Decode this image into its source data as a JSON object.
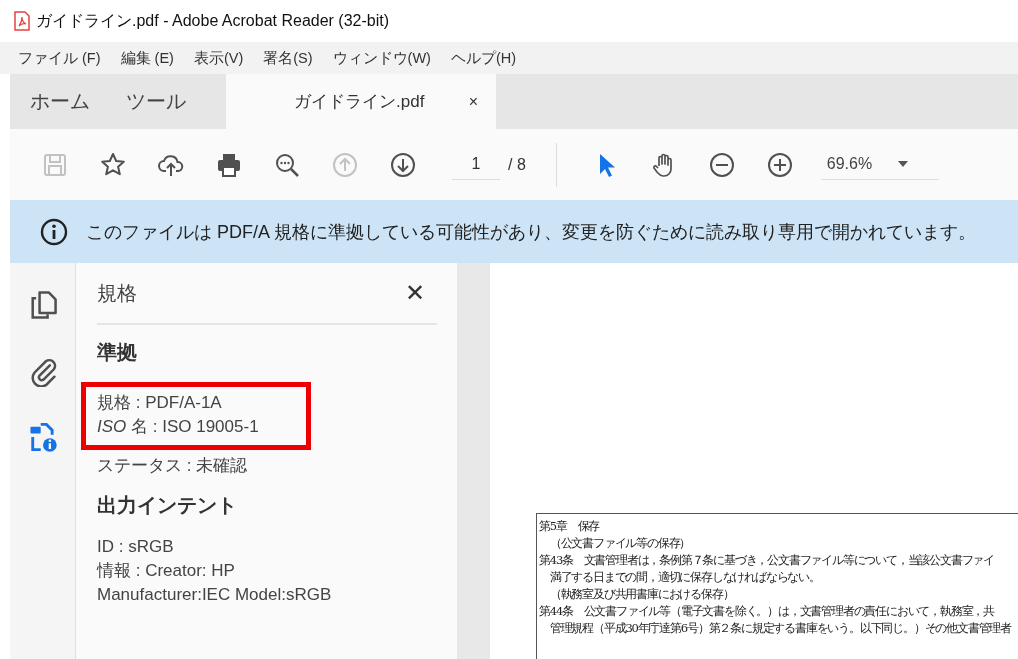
{
  "window": {
    "title": "ガイドライン.pdf - Adobe Acrobat Reader (32-bit)"
  },
  "menu": [
    "ファイル (F)",
    "編集 (E)",
    "表示(V)",
    "署名(S)",
    "ウィンドウ(W)",
    "ヘルプ(H)"
  ],
  "tabs": [
    {
      "label": "ホーム",
      "selected": false
    },
    {
      "label": "ツール",
      "selected": false
    },
    {
      "label": "ガイドライン.pdf",
      "selected": true,
      "close": "×"
    }
  ],
  "toolbar": {
    "buttons": [
      {
        "kind": "save",
        "disabled": true
      },
      {
        "kind": "star",
        "disabled": false
      },
      {
        "kind": "upload",
        "disabled": false
      },
      {
        "kind": "print",
        "disabled": false
      },
      {
        "kind": "find",
        "disabled": false
      },
      {
        "kind": "prev",
        "disabled": true
      },
      {
        "kind": "next",
        "disabled": false
      }
    ],
    "page": "1",
    "page_total": "/ 8",
    "tools": [
      {
        "kind": "pointer",
        "selected": true
      },
      {
        "kind": "hand",
        "selected": false
      },
      {
        "kind": "zoom-out",
        "selected": false
      },
      {
        "kind": "zoom-in",
        "selected": false
      }
    ],
    "zoom": "69.6%"
  },
  "banner": {
    "text": "このファイルは PDF/A 規格に準拠している可能性があり、変更を防ぐために読み取り専用で開かれています。"
  },
  "rail": [
    {
      "kind": "pages",
      "selected": false
    },
    {
      "kind": "attachments",
      "selected": false
    },
    {
      "kind": "standards",
      "selected": true
    }
  ],
  "panel": {
    "title": "規格",
    "close": "✕",
    "sections": [
      {
        "heading": "準拠",
        "highlighted": true,
        "lines": [
          "規格 : PDF/A-1A",
          "*ISO* 名 : ISO 19005-1"
        ],
        "after": [
          "ステータス : 未確認"
        ]
      },
      {
        "heading": "出力インテント",
        "lines": [
          "ID : sRGB",
          "情報 : Creator: HP",
          "Manufacturer:IEC Model:sRGB"
        ]
      }
    ]
  },
  "document": {
    "lines": [
      "第5章　保存",
      "　（公文書ファイル等の保存）",
      "第43条　文書管理者は，条例第７条に基づき，公文書ファイル等について，当該公文書ファイ",
      "　満了する日までの間，適切に保存しなければならない。",
      "　（執務室及び共用書庫における保存）",
      "第44条　公文書ファイル等（電子文書を除く。）は，文書管理者の責任において，執務室，共",
      "　管理規程（平成30年庁達第6号）第２条に規定する書庫をいう。以下同じ。）その他文書管理者"
    ]
  }
}
